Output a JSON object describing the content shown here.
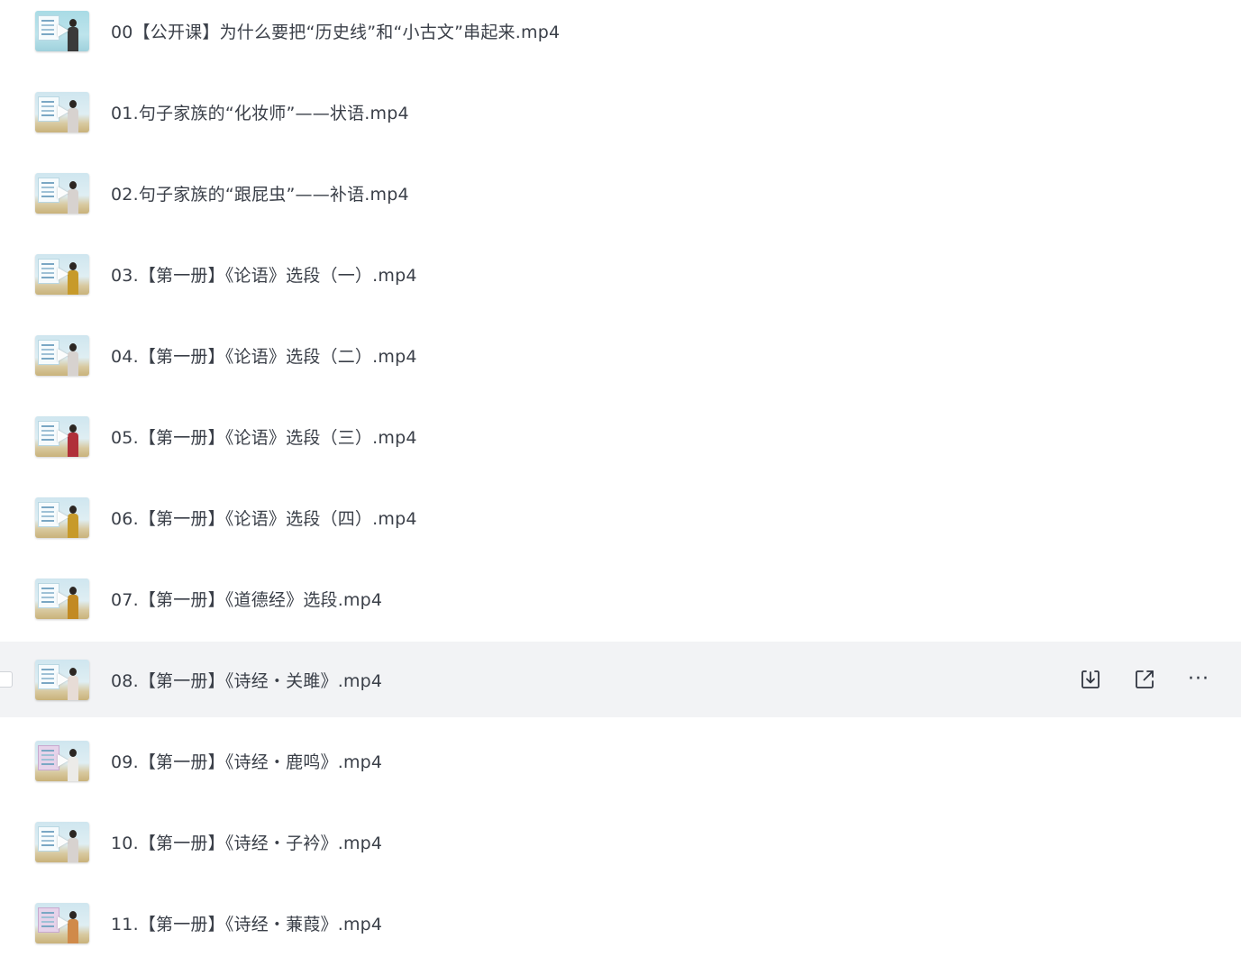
{
  "files": [
    {
      "name": "00【公开课】为什么要把“历史线”和“小古文”串起来.mp4",
      "type": "video"
    },
    {
      "name": "01.句子家族的“化妆师”——状语.mp4",
      "type": "video"
    },
    {
      "name": "02.句子家族的“跟屁虫”——补语.mp4",
      "type": "video"
    },
    {
      "name": "03.【第一册】《论语》选段（一）.mp4",
      "type": "video"
    },
    {
      "name": "04.【第一册】《论语》选段（二）.mp4",
      "type": "video"
    },
    {
      "name": "05.【第一册】《论语》选段（三）.mp4",
      "type": "video"
    },
    {
      "name": "06.【第一册】《论语》选段（四）.mp4",
      "type": "video"
    },
    {
      "name": "07.【第一册】《道德经》选段.mp4",
      "type": "video"
    },
    {
      "name": "08.【第一册】《诗经・关雎》.mp4",
      "type": "video",
      "hovered": true
    },
    {
      "name": "09.【第一册】《诗经・鹿鸣》.mp4",
      "type": "video"
    },
    {
      "name": "10.【第一册】《诗经・子衿》.mp4",
      "type": "video"
    },
    {
      "name": "11.【第一册】《诗经・蒹葭》.mp4",
      "type": "video"
    }
  ],
  "row_actions": {
    "download_icon": "download-icon",
    "share_icon": "share-icon",
    "more_icon": "more-icon",
    "more_glyph": "···"
  },
  "colors": {
    "hover_background": "#f2f3f5",
    "text": "#3a3f48",
    "icon": "#303540"
  }
}
